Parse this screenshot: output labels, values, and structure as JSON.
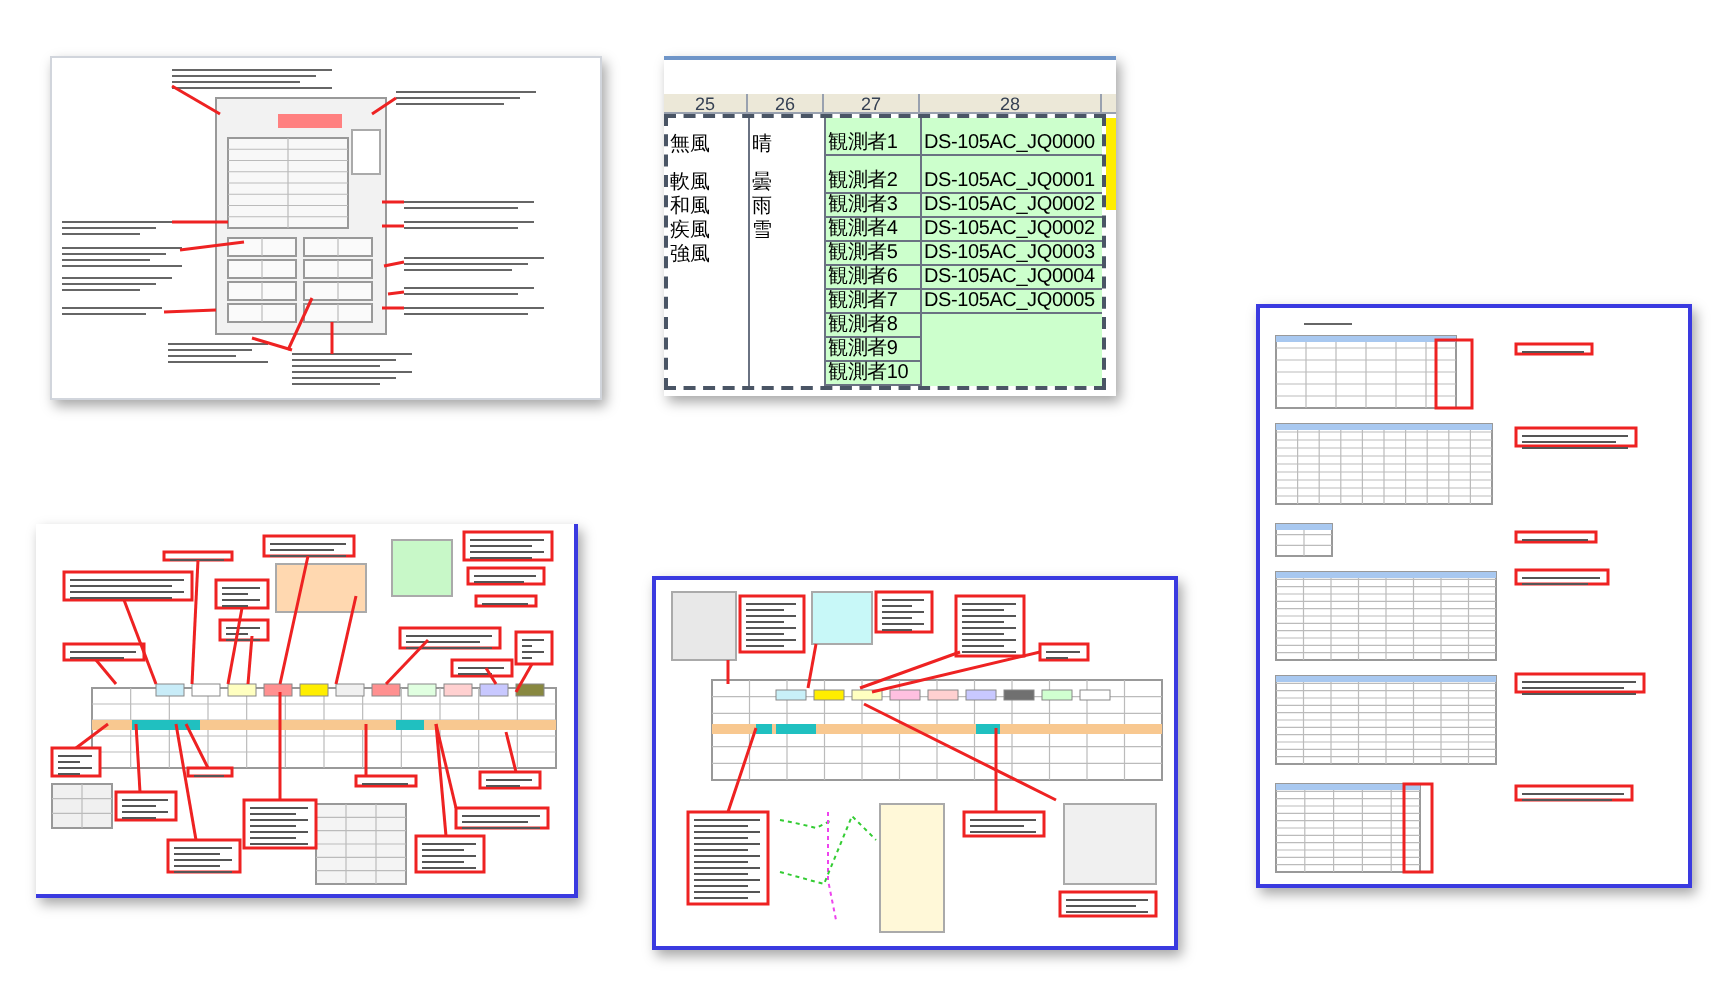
{
  "spreadsheet": {
    "columns": [
      "25",
      "26",
      "27",
      "28"
    ],
    "rows": [
      {
        "wind": "無風",
        "weather": "晴",
        "observer": "観測者1",
        "device": "DS-105AC_JQ0000"
      },
      {
        "wind": "軟風",
        "weather": "曇",
        "observer": "観測者2",
        "device": "DS-105AC_JQ0001"
      },
      {
        "wind": "和風",
        "weather": "雨",
        "observer": "観測者3",
        "device": "DS-105AC_JQ0002"
      },
      {
        "wind": "疾風",
        "weather": "雪",
        "observer": "観測者4",
        "device": "DS-105AC_JQ0002"
      },
      {
        "wind": "強風",
        "observer": "観測者5",
        "device": "DS-105AC_JQ0003"
      },
      {
        "observer": "観測者6",
        "device": "DS-105AC_JQ0004"
      },
      {
        "observer": "観測者7",
        "device": "DS-105AC_JQ0005"
      },
      {
        "observer": "観測者8"
      },
      {
        "observer": "観測者9"
      },
      {
        "observer": "観測者10"
      }
    ]
  }
}
